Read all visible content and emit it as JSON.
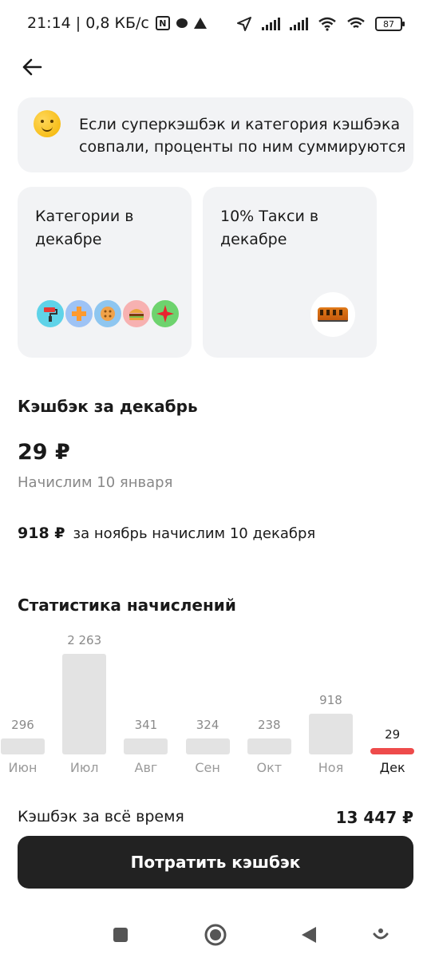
{
  "status_bar": {
    "time_speed": "21:14 | 0,8 КБ/с",
    "nfc_glyph": "N",
    "battery": "87"
  },
  "info_card": {
    "text": "Если суперкэшбэк и категория кэшбэка совпали, проценты по ним суммируются",
    "icon": "smile-emoji-icon"
  },
  "category_cards": [
    {
      "title": "Категории в декабре",
      "icons": [
        "paint-roller-icon",
        "pharmacy-cross-icon",
        "button-icon",
        "burger-icon",
        "star-sparkle-icon"
      ],
      "icon_colors": [
        "#5fd3e8",
        "#9ec3f5",
        "#8ec6f0",
        "#f7b1b1",
        "#6ed36e"
      ]
    },
    {
      "title": "10% Такси в декабре",
      "icons": [
        "taxi-sign-icon"
      ]
    }
  ],
  "cashback": {
    "section_title": "Кэшбэк за декабрь",
    "amount": "29 ₽",
    "accrual_note": "Начислим 10 января",
    "prev_amount": "918 ₽",
    "prev_note": "за ноябрь начислим 10 декабря"
  },
  "stats": {
    "title": "Статистика начислений"
  },
  "chart_data": {
    "type": "bar",
    "categories": [
      "Июн",
      "Июл",
      "Авг",
      "Сен",
      "Окт",
      "Ноя",
      "Дек"
    ],
    "values": [
      296,
      2263,
      341,
      324,
      238,
      918,
      29
    ],
    "value_labels": [
      "296",
      "2 263",
      "341",
      "324",
      "238",
      "918",
      "29"
    ],
    "highlight_index": 6,
    "colors": {
      "bar": "#e3e3e3",
      "highlight": "#ee4b4b"
    }
  },
  "totals": {
    "label": "Кэшбэк за всё время",
    "value": "13 447 ₽"
  },
  "actions": {
    "spend_label": "Потратить кэшбэк"
  },
  "nav": {
    "buttons": [
      "recents-square-icon",
      "home-circle-icon",
      "back-triangle-icon",
      "assistant-icon"
    ]
  }
}
